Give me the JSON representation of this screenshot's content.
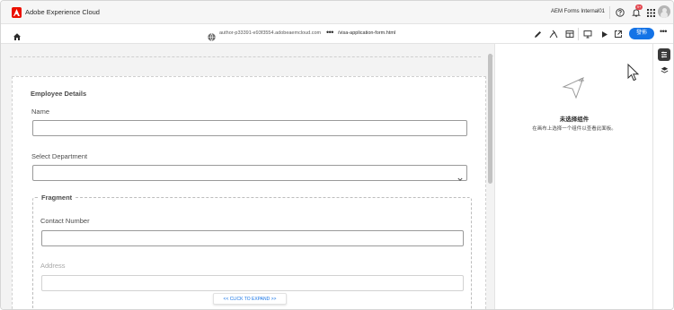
{
  "topbar": {
    "brand": "Adobe Experience Cloud",
    "org": "AEM Forms Internal01",
    "notification_count": "9+"
  },
  "toolbar": {
    "host": "author-p33391-e93f3554.adobeaemcloud.com",
    "dots": "•••",
    "path": "/visa-application-form.html",
    "publish_label": "發佈",
    "more": "•••"
  },
  "form": {
    "panel_title": "Employee Details",
    "name_label": "Name",
    "department_label": "Select Department",
    "fragment_title": "Fragment",
    "contact_label": "Contact Number",
    "address_label": "Address",
    "expand_label": "<< CLICK TO EXPAND >>"
  },
  "properties": {
    "empty_title": "未选择组件",
    "empty_desc": "在画布上选择一个组件以查看此面板。"
  },
  "colors": {
    "accent": "#1473e6",
    "adobe_red": "#eb1000",
    "badge": "#e34850"
  },
  "icons": {
    "home": "home-icon",
    "globe": "globe-icon",
    "help": "help-icon",
    "bell": "bell-icon",
    "apps": "apps-grid-icon",
    "edit": "pencil-icon",
    "properties": "properties-icon",
    "layers": "layers-icon"
  }
}
